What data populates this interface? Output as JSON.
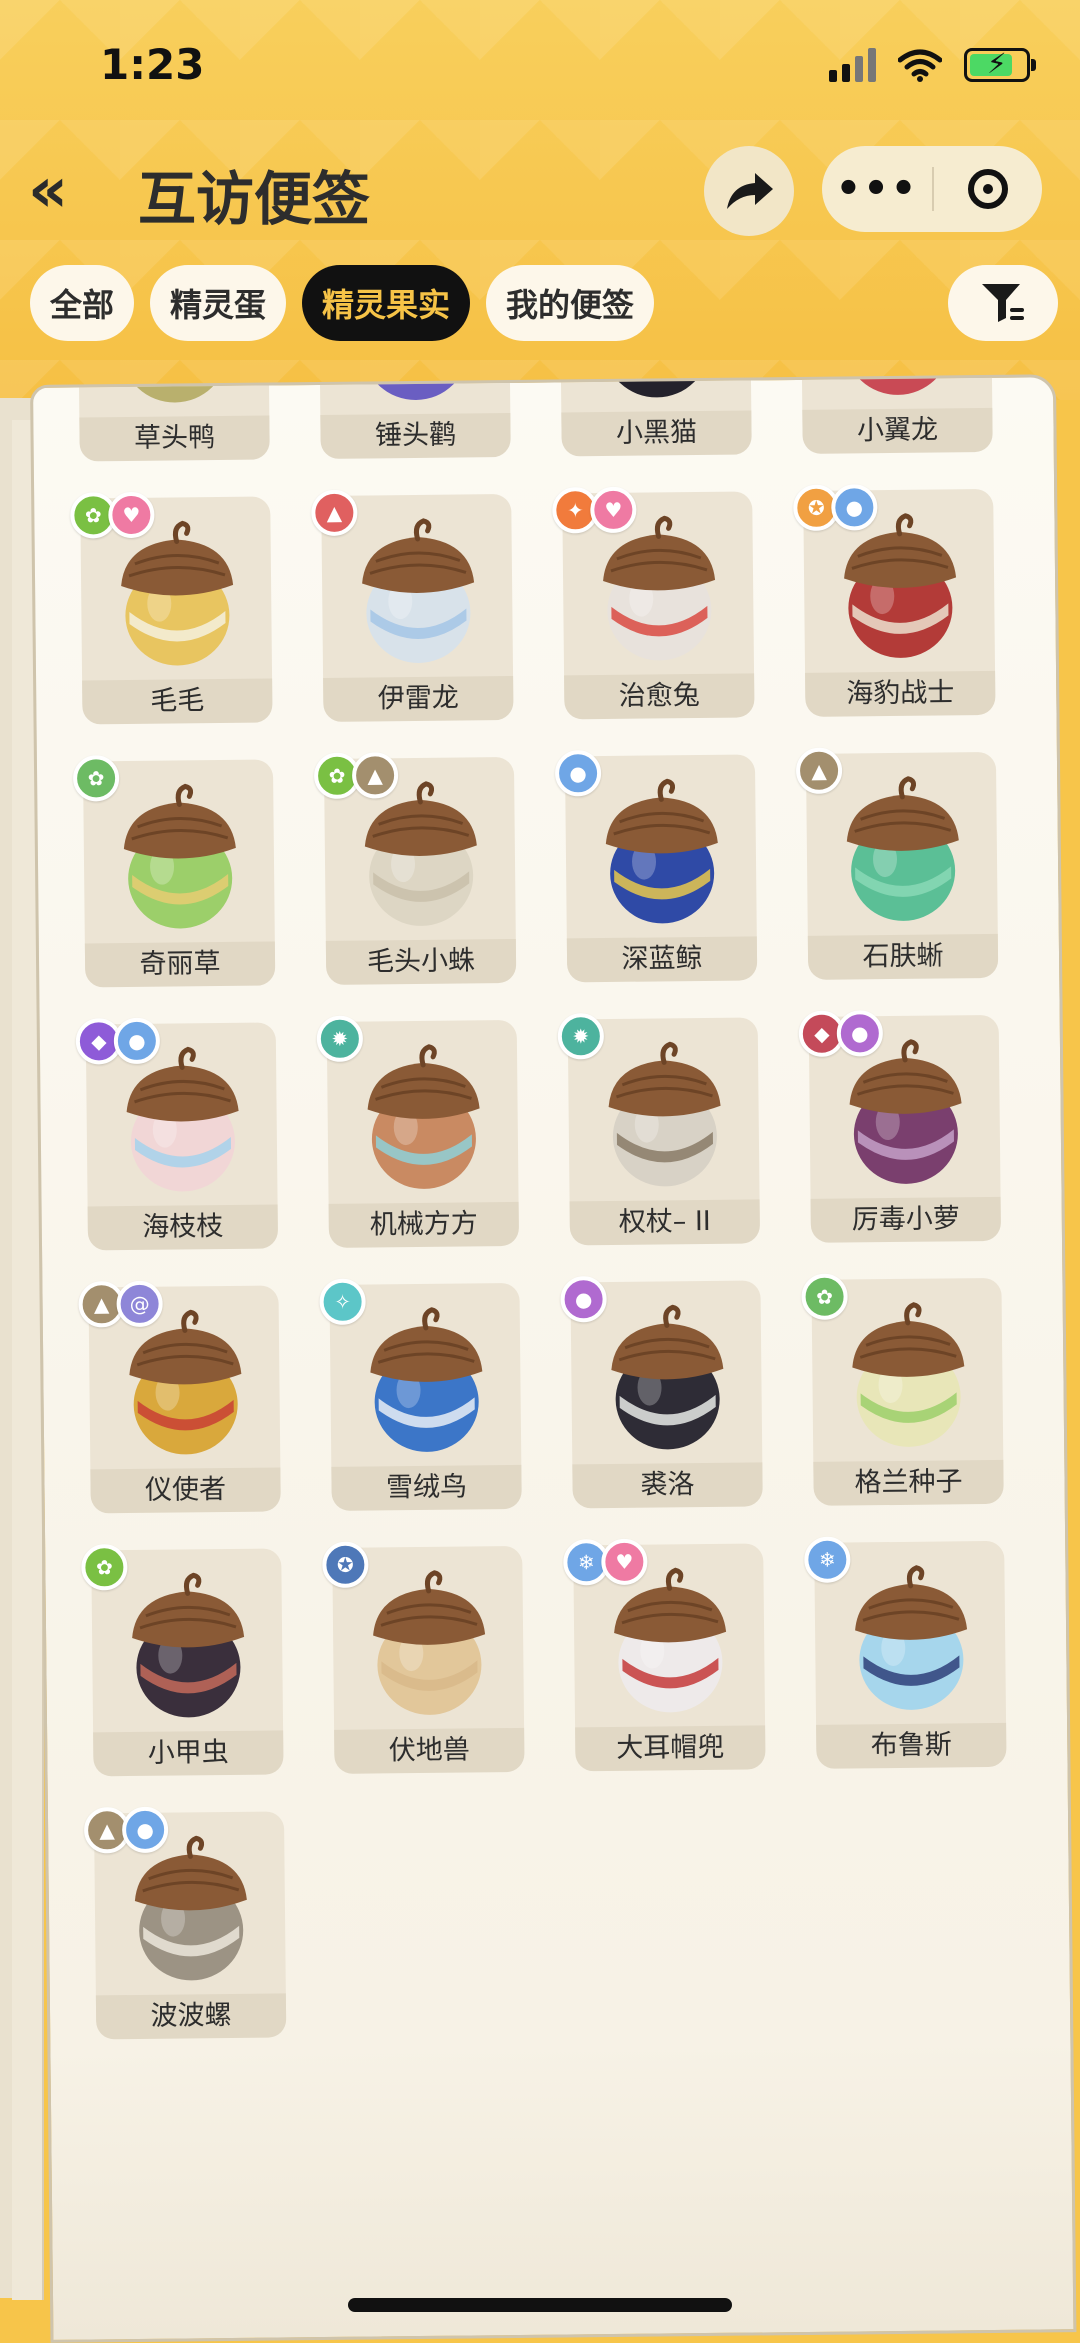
{
  "status_bar": {
    "time": "1:23"
  },
  "header": {
    "back_glyph": "«",
    "title": "互访便签",
    "more_glyph": "•••"
  },
  "tabs": [
    {
      "label": "全部",
      "active": false
    },
    {
      "label": "精灵蛋",
      "active": false
    },
    {
      "label": "精灵果实",
      "active": true
    },
    {
      "label": "我的便签",
      "active": false
    }
  ],
  "colors": {
    "accent": "#f6c347",
    "active_tab_bg": "#111111",
    "page_bg": "#f7c54a"
  },
  "items": [
    {
      "name": "草头鸭",
      "body": "#b9b06d",
      "band": "#e8e4d2",
      "badges": []
    },
    {
      "name": "锤头鹳",
      "body": "#6a5ec2",
      "band": "#d8c35c",
      "badges": []
    },
    {
      "name": "小黑猫",
      "body": "#24222c",
      "band": "#8b6fd8",
      "badges": []
    },
    {
      "name": "小翼龙",
      "body": "#c94a55",
      "band": "#3fa8a6",
      "badges": []
    },
    {
      "name": "毛毛",
      "body": "#e8c560",
      "band": "#f4f0de",
      "badges": [
        {
          "color": "#7ac043",
          "icon": "leaf-bug-icon",
          "glyph": "✿"
        },
        {
          "color": "#ef7aa3",
          "icon": "heart-icon",
          "glyph": "♥"
        }
      ]
    },
    {
      "name": "伊雷龙",
      "body": "#d8e2ea",
      "band": "#a4c6e6",
      "badges": [
        {
          "color": "#e06060",
          "icon": "demon-icon",
          "glyph": "▲"
        }
      ]
    },
    {
      "name": "治愈兔",
      "body": "#e8e2dc",
      "band": "#d94a42",
      "badges": [
        {
          "color": "#f17b3c",
          "icon": "fire-icon",
          "glyph": "✦"
        },
        {
          "color": "#ef7aa3",
          "icon": "heart-icon",
          "glyph": "♥"
        }
      ]
    },
    {
      "name": "海豹战士",
      "body": "#b33b38",
      "band": "#ece2cf",
      "badges": [
        {
          "color": "#f1a042",
          "icon": "warrior-icon",
          "glyph": "✪"
        },
        {
          "color": "#6fa6e6",
          "icon": "water-icon",
          "glyph": "●"
        }
      ]
    },
    {
      "name": "奇丽草",
      "body": "#9ccf6a",
      "band": "#e8cc72",
      "badges": [
        {
          "color": "#6dbb64",
          "icon": "grass-icon",
          "glyph": "✿"
        }
      ]
    },
    {
      "name": "毛头小蛛",
      "body": "#ddd6c4",
      "band": "#c9c0aa",
      "badges": [
        {
          "color": "#7ac043",
          "icon": "bug-icon",
          "glyph": "✿"
        },
        {
          "color": "#a38f6e",
          "icon": "ground-icon",
          "glyph": "▲"
        }
      ]
    },
    {
      "name": "深蓝鲸",
      "body": "#2f4aa6",
      "band": "#e8c84c",
      "badges": [
        {
          "color": "#6fa6e6",
          "icon": "water-icon",
          "glyph": "●"
        }
      ]
    },
    {
      "name": "石肤蜥",
      "body": "#5bbf96",
      "band": "#8ad8b6",
      "badges": [
        {
          "color": "#a38f6e",
          "icon": "ground-icon",
          "glyph": "▲"
        }
      ]
    },
    {
      "name": "海枝枝",
      "body": "#f1d6d6",
      "band": "#a6d2ec",
      "badges": [
        {
          "color": "#8e5bd8",
          "icon": "ghost-icon",
          "glyph": "◆"
        },
        {
          "color": "#6fa6e6",
          "icon": "water-icon",
          "glyph": "●"
        }
      ]
    },
    {
      "name": "机械方方",
      "body": "#c98a62",
      "band": "#8fd0d8",
      "badges": [
        {
          "color": "#4db39e",
          "icon": "gear-icon",
          "glyph": "✹"
        }
      ]
    },
    {
      "name": "权杖– II",
      "body": "#d8d2c6",
      "band": "#8a7b66",
      "badges": [
        {
          "color": "#4db39e",
          "icon": "gear-icon",
          "glyph": "✹"
        }
      ]
    },
    {
      "name": "厉毒小萝",
      "body": "#7a3f6e",
      "band": "#c4a0c8",
      "badges": [
        {
          "color": "#c44a5a",
          "icon": "demon-icon",
          "glyph": "◆"
        },
        {
          "color": "#b06ad0",
          "icon": "poison-icon",
          "glyph": "●"
        }
      ]
    },
    {
      "name": "仪使者",
      "body": "#d9a83c",
      "band": "#c84034",
      "badges": [
        {
          "color": "#a38f6e",
          "icon": "ground-icon",
          "glyph": "▲"
        },
        {
          "color": "#8e86d8",
          "icon": "spiral-icon",
          "glyph": "@"
        }
      ]
    },
    {
      "name": "雪绒鸟",
      "body": "#3c76c8",
      "band": "#e8eef6",
      "badges": [
        {
          "color": "#5cc6c8",
          "icon": "wing-icon",
          "glyph": "✧"
        }
      ]
    },
    {
      "name": "裘洛",
      "body": "#2e2c36",
      "band": "#e6eae6",
      "badges": [
        {
          "color": "#b06ad0",
          "icon": "poison-icon",
          "glyph": "●"
        }
      ]
    },
    {
      "name": "格兰种子",
      "body": "#e8e6b8",
      "band": "#9ccf6a",
      "badges": [
        {
          "color": "#6dbb64",
          "icon": "grass-icon",
          "glyph": "✿"
        }
      ]
    },
    {
      "name": "小甲虫",
      "body": "#3a2f3c",
      "band": "#c46a5a",
      "badges": [
        {
          "color": "#7ac043",
          "icon": "bug-icon",
          "glyph": "✿"
        }
      ]
    },
    {
      "name": "伏地兽",
      "body": "#e2c79a",
      "band": "#d8b88a",
      "badges": [
        {
          "color": "#4e78b8",
          "icon": "star-icon",
          "glyph": "✪"
        }
      ]
    },
    {
      "name": "大耳帽兜",
      "body": "#eeeaea",
      "band": "#c43a3a",
      "badges": [
        {
          "color": "#6fa6e6",
          "icon": "ice-icon",
          "glyph": "❄"
        },
        {
          "color": "#ef7aa3",
          "icon": "heart-icon",
          "glyph": "♥"
        }
      ]
    },
    {
      "name": "布鲁斯",
      "body": "#a6d6ec",
      "band": "#2e3f7a",
      "badges": [
        {
          "color": "#6fa6e6",
          "icon": "ice-icon",
          "glyph": "❄"
        }
      ]
    },
    {
      "name": "波波螺",
      "body": "#9c9384",
      "band": "#ece6da",
      "badges": [
        {
          "color": "#a38f6e",
          "icon": "ground-icon",
          "glyph": "▲"
        },
        {
          "color": "#6fa6e6",
          "icon": "water-icon",
          "glyph": "●"
        }
      ]
    }
  ]
}
